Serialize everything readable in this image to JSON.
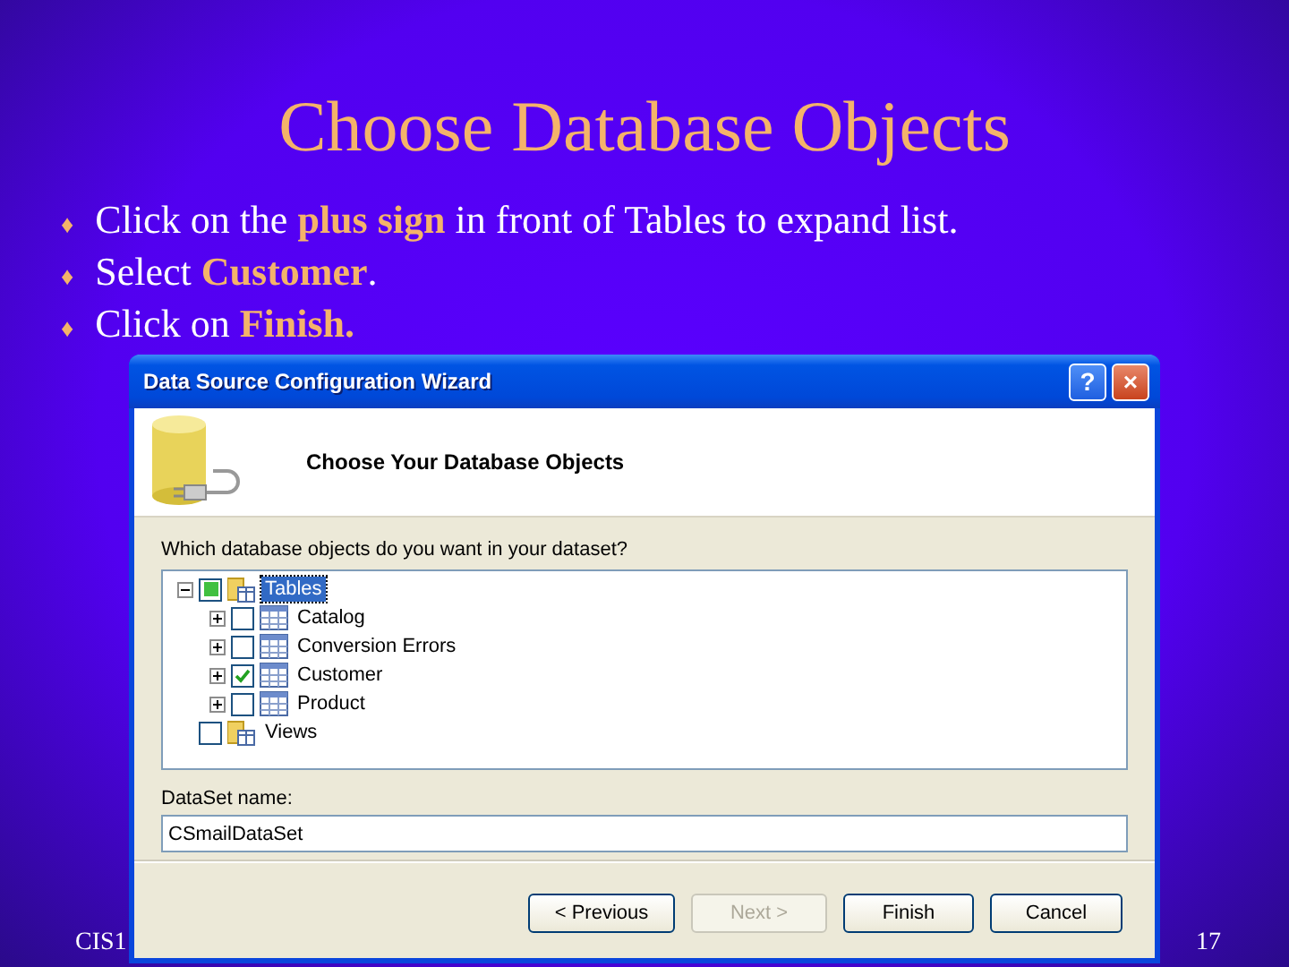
{
  "slide": {
    "title": "Choose Database Objects",
    "bullets": [
      {
        "marker": "♦",
        "text": "Click on the **plus sign** in front of Tables to expand list."
      },
      {
        "marker": "♦",
        "text": "Select **Customer**."
      },
      {
        "marker": "♦",
        "text": "Click on **Finish.**"
      }
    ],
    "footer_left": "CIS1",
    "page_number": "17"
  },
  "window": {
    "title": "Data Source Configuration Wizard",
    "help_button": "?",
    "close_button": "×",
    "heading": "Choose Your Database Objects",
    "tree_label": "Which database objects do you want in your dataset?",
    "tree": [
      {
        "label": "Tables",
        "kind": "folder",
        "expanded": true,
        "checked": true,
        "partial": true,
        "selected": true,
        "children": [
          {
            "label": "Catalog",
            "kind": "table",
            "expanded": false,
            "checked": false,
            "selected": false
          },
          {
            "label": "Conversion Errors",
            "kind": "table",
            "expanded": false,
            "checked": false,
            "selected": false
          },
          {
            "label": "Customer",
            "kind": "table",
            "expanded": false,
            "checked": true,
            "selected": false
          },
          {
            "label": "Product",
            "kind": "table",
            "expanded": false,
            "checked": false,
            "selected": false
          }
        ]
      },
      {
        "label": "Views",
        "kind": "folder",
        "checked": false,
        "selected": false
      }
    ],
    "dataset_label": "DataSet name:",
    "dataset_value": "CSmailDataSet",
    "buttons": [
      {
        "label": "< Previous",
        "disabled": false
      },
      {
        "label": "Next >",
        "disabled": true
      },
      {
        "label": "Finish",
        "disabled": false
      },
      {
        "label": "Cancel",
        "disabled": false
      }
    ]
  }
}
